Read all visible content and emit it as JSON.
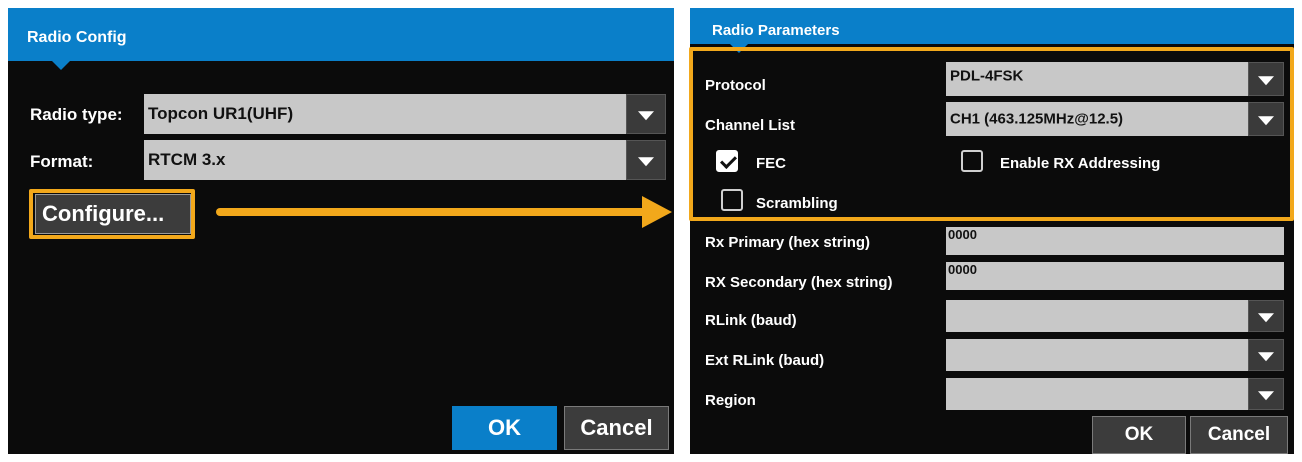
{
  "colors": {
    "accent": "#0a7fc9",
    "highlight": "#f2a81b",
    "panel_bg": "#0b0b0b"
  },
  "radio_config": {
    "title": "Radio Config",
    "radio_type_label": "Radio type:",
    "radio_type_value": "Topcon UR1(UHF)",
    "format_label": "Format:",
    "format_value": "RTCM 3.x",
    "configure_label": "Configure...",
    "ok_label": "OK",
    "cancel_label": "Cancel"
  },
  "radio_parameters": {
    "title": "Radio Parameters",
    "protocol_label": "Protocol",
    "protocol_value": "PDL-4FSK",
    "channel_list_label": "Channel List",
    "channel_list_value": "CH1 (463.125MHz@12.5)",
    "fec_label": "FEC",
    "fec_checked": true,
    "enable_rx_addressing_label": "Enable RX Addressing",
    "enable_rx_addressing_checked": false,
    "scrambling_label": "Scrambling",
    "scrambling_checked": false,
    "rx_primary_label": "Rx Primary (hex string)",
    "rx_primary_value": "0000",
    "rx_secondary_label": "RX Secondary (hex string)",
    "rx_secondary_value": "0000",
    "rlink_label": "RLink (baud)",
    "rlink_value": "",
    "ext_rlink_label": "Ext RLink (baud)",
    "ext_rlink_value": "",
    "region_label": "Region",
    "region_value": "",
    "ok_label": "OK",
    "cancel_label": "Cancel"
  },
  "annotation": {
    "arrow_icon": "arrow-right-icon"
  }
}
